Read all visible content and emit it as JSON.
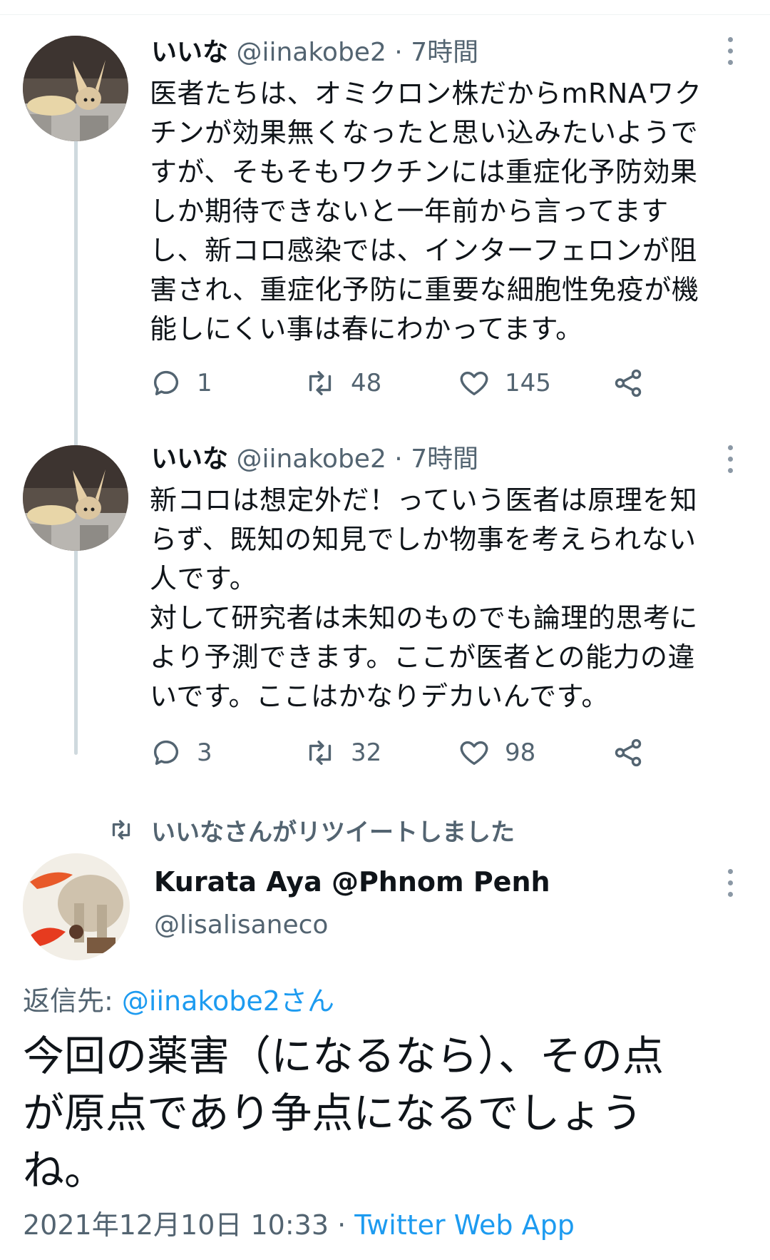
{
  "tweets": [
    {
      "name": "いいな",
      "handle": "@iinakobe2",
      "dot": "·",
      "time": "7時間",
      "text": "医者たちは、オミクロン株だからmRNAワク\nチンが効果無くなったと思い込みたいようで\nすが、そもそもワクチンには重症化予防効果\nしか期待できないと一年前から言ってます\nし、新コロ感染では、インターフェロンが阻\n害され、重症化予防に重要な細胞性免疫が機\n能しにくい事は春にわかってます。",
      "replies": "1",
      "retweets": "48",
      "likes": "145"
    },
    {
      "name": "いいな",
      "handle": "@iinakobe2",
      "dot": "·",
      "time": "7時間",
      "text": "新コロは想定外だ！っていう医者は原理を知\nらず、既知の知見でしか物事を考えられない\n人です。\n対して研究者は未知のものでも論理的思考に\nより予測できます。ここが医者との能力の違\nいです。ここはかなりデカいんです。",
      "replies": "3",
      "retweets": "32",
      "likes": "98"
    }
  ],
  "retweet_notice": "いいなさんがリツイートしました",
  "main_tweet": {
    "name": "Kurata Aya @Phnom Penh",
    "handle": "@lisalisaneco",
    "reply_prefix": "返信先: ",
    "reply_handle": "@iinakobe2さん",
    "text": "今回の薬害（になるなら）、その点\nが原点であり争点になるでしょう\nね。",
    "datetime": "2021年12月10日 10:33",
    "separator": " · ",
    "via": "Twitter Web App"
  },
  "icons": {
    "reply": "speech-bubble-icon",
    "retweet": "retweet-arrows-icon",
    "like": "heart-icon",
    "share": "share-icon",
    "more": "vertical-ellipsis-icon"
  },
  "colors": {
    "link": "#1d9bf0",
    "secondary_text": "#536471",
    "thread_line": "#cfd9de"
  }
}
